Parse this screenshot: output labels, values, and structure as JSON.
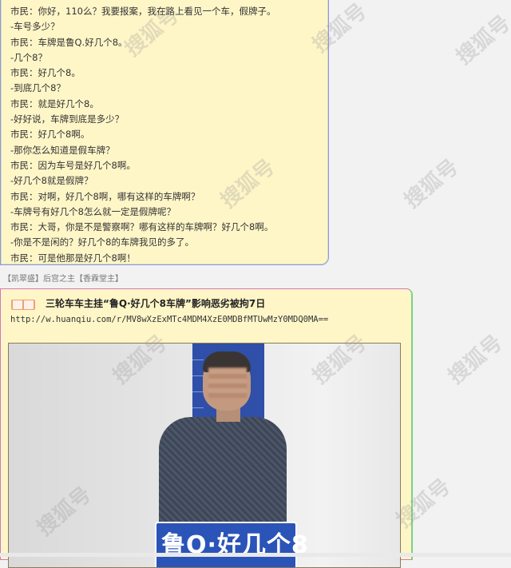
{
  "chat": {
    "lines": [
      "市民：你好，110么？我要报案，我在路上看见一个车，假牌子。",
      "-车号多少？",
      "市民：车牌是鲁Q.好几个8。",
      "-几个8？",
      "市民：好几个8。",
      "-到底几个8？",
      "市民：就是好几个8。",
      "-好好说，车牌到底是多少？",
      "市民：好几个8啊。",
      "-那你怎么知道是假车牌？",
      "市民：因为车号是好几个8啊。",
      "-好几个8就是假牌？",
      "市民：对啊，好几个8啊，哪有这样的车牌啊？",
      "-车牌号有好几个8怎么就一定是假牌呢？",
      "市民：大哥，你是不是警察啊？哪有这样的车牌啊？好几个8啊。",
      "-你是不是闲的？好几个8的车牌我见的多了。",
      "市民：可是他那是好几个8啊！"
    ]
  },
  "caption": "【凯翠盛】后宫之主【香霖堂主】",
  "post": {
    "title": "三轮车车主挂“鲁Q·好几个8车牌”影响恶劣被拘7日",
    "url": "http://w.huanqiu.com/r/MV8wXzExMTc4MDM4XzE0MDBfMTUwMzY0MDQ0MA==",
    "plate_text": "鲁Q·好几个8"
  },
  "watermark_text": "搜狐号"
}
